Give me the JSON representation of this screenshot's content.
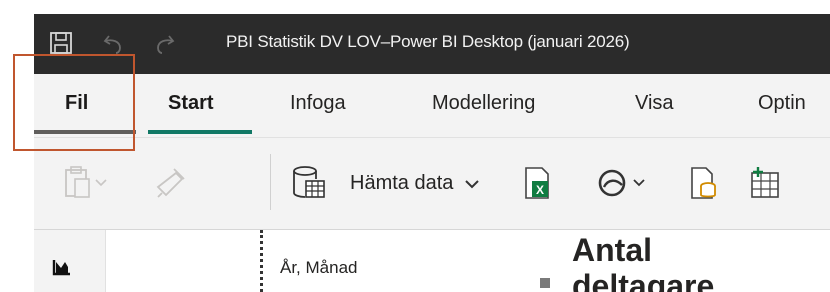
{
  "window": {
    "title": "PBI Statistik DV LOV–Power BI Desktop (januari 2026)",
    "icons": [
      "save-icon",
      "undo-icon",
      "redo-icon"
    ],
    "bar_color": "#2b2b2b"
  },
  "ribbon_tabs": [
    {
      "label": "Fil"
    },
    {
      "label": "Start"
    },
    {
      "label": "Infoga"
    },
    {
      "label": "Modellering"
    },
    {
      "label": "Visa"
    },
    {
      "label": "Optin"
    }
  ],
  "selected_tab": "Start",
  "accent_color": "#117865",
  "annotation_color": "#c0562e",
  "toolbar": {
    "get_data_label": "Hämta data",
    "icons": [
      "paste-icon",
      "format-painter-icon",
      "get-data-icon",
      "excel-icon",
      "onelake-icon",
      "sql-icon",
      "enter-data-icon"
    ]
  },
  "left_nav": {
    "icons": [
      "report-view-icon"
    ]
  },
  "canvas": {
    "slicer_label": "År, Månad",
    "visual_title_line1": "Antal",
    "visual_title_line2": "deltagare"
  }
}
